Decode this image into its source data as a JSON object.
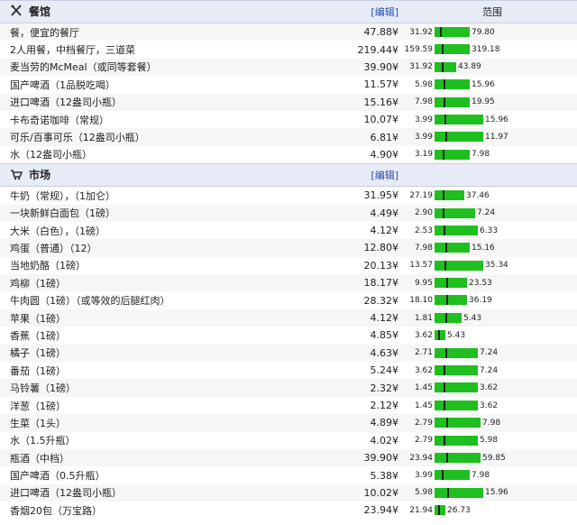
{
  "currency": "¥",
  "colors": {
    "bar": "#1fbf1f",
    "section_bg": "#e7ebf6",
    "link": "#2a4bb0"
  },
  "sections": [
    {
      "icon": "utensils-icon",
      "title": "餐馆",
      "edit_label": "[编辑]",
      "range_header": "范围",
      "items": [
        {
          "name": "餐，便宜的餐厅",
          "price": "47.88¥",
          "low": "31.92",
          "high": "79.80",
          "fill": 0.65,
          "tick": 0.16
        },
        {
          "name": "2人用餐，中档餐厅，三道菜",
          "price": "219.44¥",
          "low": "159.59",
          "high": "319.18",
          "fill": 0.65,
          "tick": 0.2
        },
        {
          "name": "麦当劳的McMeal（或同等套餐）",
          "price": "39.90¥",
          "low": "31.92",
          "high": "43.89",
          "fill": 0.4,
          "tick": 0.35
        },
        {
          "name": "国产啤酒（1品脱吃喝）",
          "price": "11.57¥",
          "low": "5.98",
          "high": "15.96",
          "fill": 0.65,
          "tick": 0.25
        },
        {
          "name": "进口啤酒（12盎司小瓶）",
          "price": "15.16¥",
          "low": "7.98",
          "high": "19.95",
          "fill": 0.65,
          "tick": 0.25
        },
        {
          "name": "卡布奇诺咖啡（常规）",
          "price": "10.07¥",
          "low": "3.99",
          "high": "15.96",
          "fill": 0.9,
          "tick": 0.2
        },
        {
          "name": "可乐/百事可乐（12盎司小瓶）",
          "price": "6.81¥",
          "low": "3.99",
          "high": "11.97",
          "fill": 0.9,
          "tick": 0.22
        },
        {
          "name": "水（12盎司小瓶）",
          "price": "4.90¥",
          "low": "3.19",
          "high": "7.98",
          "fill": 0.65,
          "tick": 0.22
        }
      ]
    },
    {
      "icon": "market-icon",
      "title": "市场",
      "edit_label": "[编辑]",
      "range_header": "",
      "items": [
        {
          "name": "牛奶（常规），（1加仑）",
          "price": "31.95¥",
          "low": "27.19",
          "high": "37.46",
          "fill": 0.55,
          "tick": 0.28
        },
        {
          "name": "一块新鲜白面包（1磅）",
          "price": "4.49¥",
          "low": "2.90",
          "high": "7.24",
          "fill": 0.75,
          "tick": 0.2
        },
        {
          "name": "大米（白色），（1磅）",
          "price": "4.12¥",
          "low": "2.53",
          "high": "6.33",
          "fill": 0.8,
          "tick": 0.2
        },
        {
          "name": "鸡蛋（普通）（12）",
          "price": "12.80¥",
          "low": "7.98",
          "high": "15.16",
          "fill": 0.65,
          "tick": 0.3
        },
        {
          "name": "当地奶酪（1磅）",
          "price": "20.13¥",
          "low": "13.57",
          "high": "35.34",
          "fill": 0.9,
          "tick": 0.2
        },
        {
          "name": "鸡柳（1磅）",
          "price": "18.17¥",
          "low": "9.95",
          "high": "23.53",
          "fill": 0.6,
          "tick": 0.35
        },
        {
          "name": "牛肉圆（1磅）（或等效的后腿红肉）",
          "price": "28.32¥",
          "low": "18.10",
          "high": "36.19",
          "fill": 0.6,
          "tick": 0.35
        },
        {
          "name": "苹果（1磅）",
          "price": "4.12¥",
          "low": "1.81",
          "high": "5.43",
          "fill": 0.5,
          "tick": 0.4
        },
        {
          "name": "香蕉（1磅）",
          "price": "4.85¥",
          "low": "3.62",
          "high": "5.43",
          "fill": 0.2,
          "tick": 0.3
        },
        {
          "name": "橘子（1磅）",
          "price": "4.63¥",
          "low": "2.71",
          "high": "7.24",
          "fill": 0.8,
          "tick": 0.25
        },
        {
          "name": "番茄（1磅）",
          "price": "5.24¥",
          "low": "3.62",
          "high": "7.24",
          "fill": 0.8,
          "tick": 0.2
        },
        {
          "name": "马铃薯（1磅）",
          "price": "2.32¥",
          "low": "1.45",
          "high": "3.62",
          "fill": 0.8,
          "tick": 0.2
        },
        {
          "name": "洋葱（1磅）",
          "price": "2.12¥",
          "low": "1.45",
          "high": "3.62",
          "fill": 0.8,
          "tick": 0.2
        },
        {
          "name": "生菜（1头）",
          "price": "4.89¥",
          "low": "2.79",
          "high": "7.98",
          "fill": 0.85,
          "tick": 0.25
        },
        {
          "name": "水（1.5升瓶）",
          "price": "4.02¥",
          "low": "2.79",
          "high": "5.98",
          "fill": 0.8,
          "tick": 0.2
        },
        {
          "name": "瓶酒（中档）",
          "price": "39.90¥",
          "low": "23.94",
          "high": "59.85",
          "fill": 0.85,
          "tick": 0.25
        },
        {
          "name": "国产啤酒（0.5升瓶）",
          "price": "5.38¥",
          "low": "3.99",
          "high": "7.98",
          "fill": 0.65,
          "tick": 0.2
        },
        {
          "name": "进口啤酒（12盎司小瓶）",
          "price": "10.02¥",
          "low": "5.98",
          "high": "15.96",
          "fill": 0.9,
          "tick": 0.25
        },
        {
          "name": "香烟20包（万宝路）",
          "price": "23.94¥",
          "low": "21.94",
          "high": "26.73",
          "fill": 0.2,
          "tick": 0.35
        }
      ]
    }
  ]
}
